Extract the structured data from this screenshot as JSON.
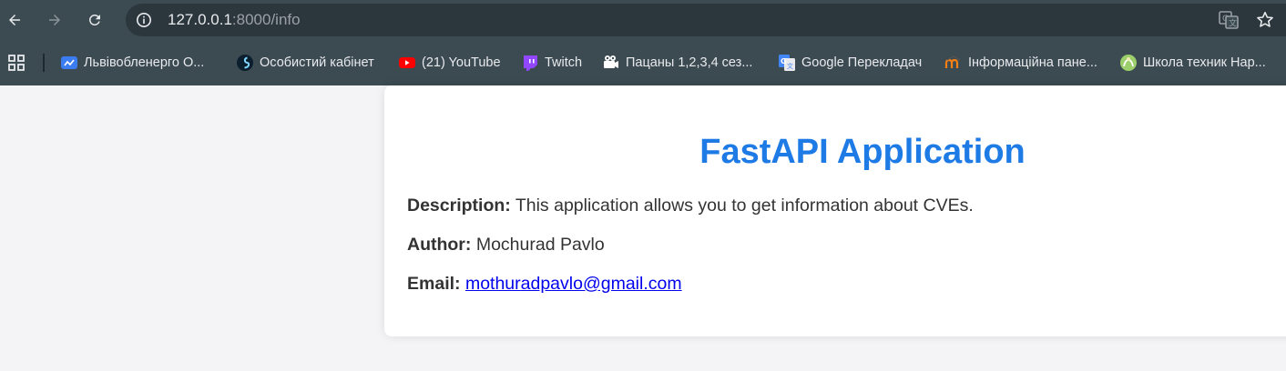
{
  "browser": {
    "url_host": "127.0.0.1",
    "url_rest": ":8000/info",
    "bookmarks": [
      {
        "label": "Львівобленерго О...",
        "icon": "lvivoblenergo-icon"
      },
      {
        "label": "Особистий кабінет",
        "icon": "sign-icon"
      },
      {
        "label": "(21) YouTube",
        "icon": "youtube-icon"
      },
      {
        "label": "Twitch",
        "icon": "twitch-icon"
      },
      {
        "label": "Пацаны 1,2,3,4 сез...",
        "icon": "film-camera-icon"
      },
      {
        "label": "Google Перекладач",
        "icon": "google-translate-icon"
      },
      {
        "label": "Інформаційна пане...",
        "icon": "moodle-icon"
      },
      {
        "label": "Школа техник Нар...",
        "icon": "school-icon"
      }
    ]
  },
  "page": {
    "title": "FastAPI Application",
    "description_label": "Description:",
    "description_value": "This application allows you to get information about CVEs.",
    "author_label": "Author:",
    "author_value": "Mochurad Pavlo",
    "email_label": "Email:",
    "email_value": "mothuradpavlo@gmail.com"
  },
  "colors": {
    "title": "#1e7be6",
    "chrome": "#3c4a52",
    "link": "#0000ee"
  }
}
